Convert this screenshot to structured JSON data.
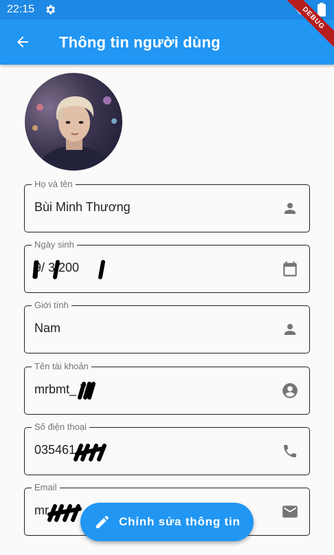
{
  "status_bar": {
    "time": "22:15",
    "settings_icon": "gear-icon",
    "wifi_icon": "wifi-icon",
    "battery_icon": "battery-icon"
  },
  "app_bar": {
    "title": "Thông tin người dùng",
    "back_icon": "arrow-back-icon",
    "color": "#2196f3"
  },
  "debug_banner": "DEBUG",
  "profile": {
    "avatar": "profile-photo",
    "fields": [
      {
        "label": "Họ và tên",
        "value": "Bùi Minh Thương",
        "icon": "person-icon"
      },
      {
        "label": "Ngày sinh",
        "value": "9/ 3/200",
        "icon": "calendar-icon"
      },
      {
        "label": "Giới tính",
        "value": "Nam",
        "icon": "person-icon"
      },
      {
        "label": "Tên tài khoản",
        "value": "mrbmt_ 7",
        "icon": "account-circle-icon"
      },
      {
        "label": "Số điện thoại",
        "value": "035461",
        "icon": "phone-icon"
      },
      {
        "label": "Email",
        "value": "mr",
        "icon": "email-icon"
      }
    ]
  },
  "fab": {
    "label": "Chỉnh sửa thông tin",
    "icon": "edit-icon"
  }
}
